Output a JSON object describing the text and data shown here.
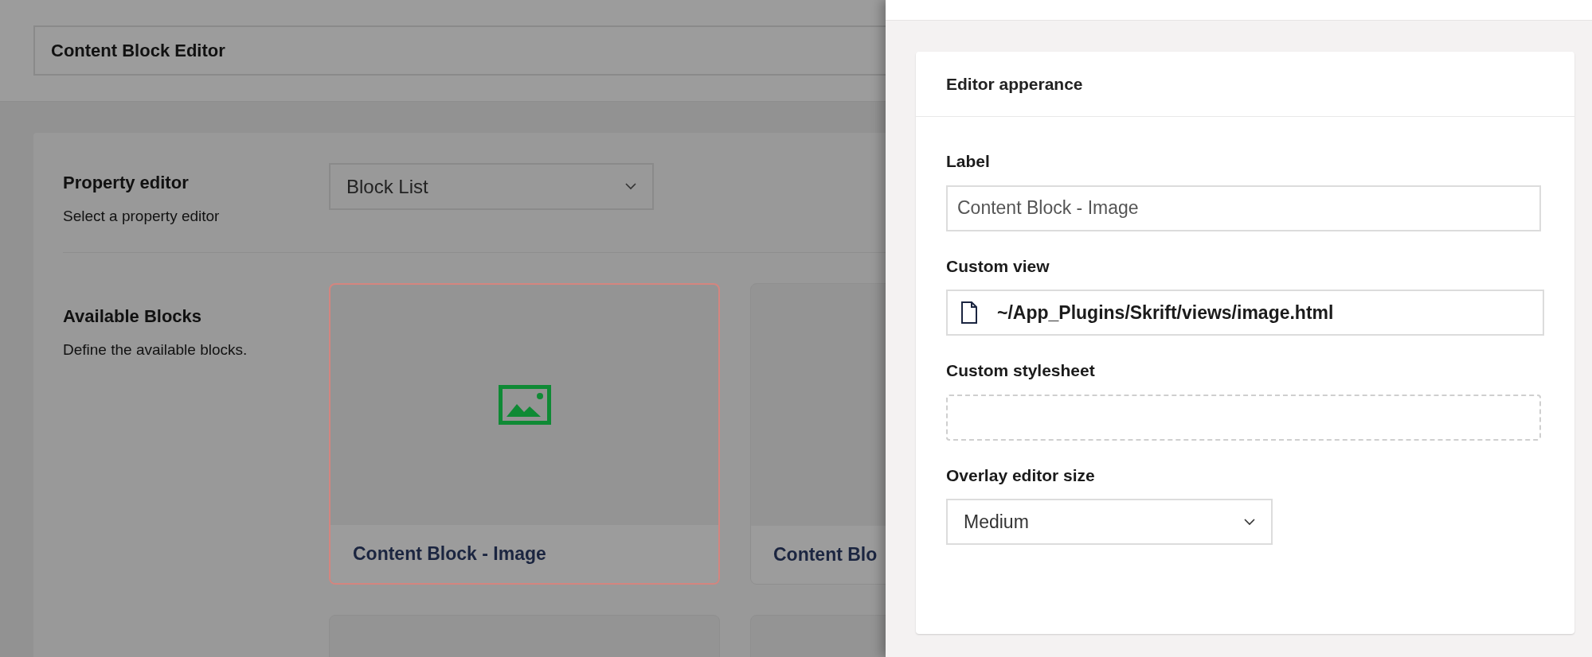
{
  "header": {
    "title": "Content Block Editor"
  },
  "property_editor": {
    "label": "Property editor",
    "description": "Select a property editor",
    "value": "Block List"
  },
  "available_blocks": {
    "label": "Available Blocks",
    "description": "Define the available blocks.",
    "blocks": [
      {
        "name": "Content Block - Image",
        "selected": true,
        "kind": "image"
      },
      {
        "name": "Content Blo",
        "selected": false,
        "kind": "blank"
      }
    ]
  },
  "panel": {
    "title": "Editor apperance",
    "fields": [
      {
        "kind": "text",
        "label": "Label",
        "value": "Content Block - Image"
      },
      {
        "kind": "file",
        "label": "Custom view",
        "value": "~/App_Plugins/Skrift/views/image.html"
      },
      {
        "kind": "picker",
        "label": "Custom stylesheet"
      },
      {
        "kind": "select",
        "label": "Overlay editor size",
        "value": "Medium"
      }
    ]
  }
}
